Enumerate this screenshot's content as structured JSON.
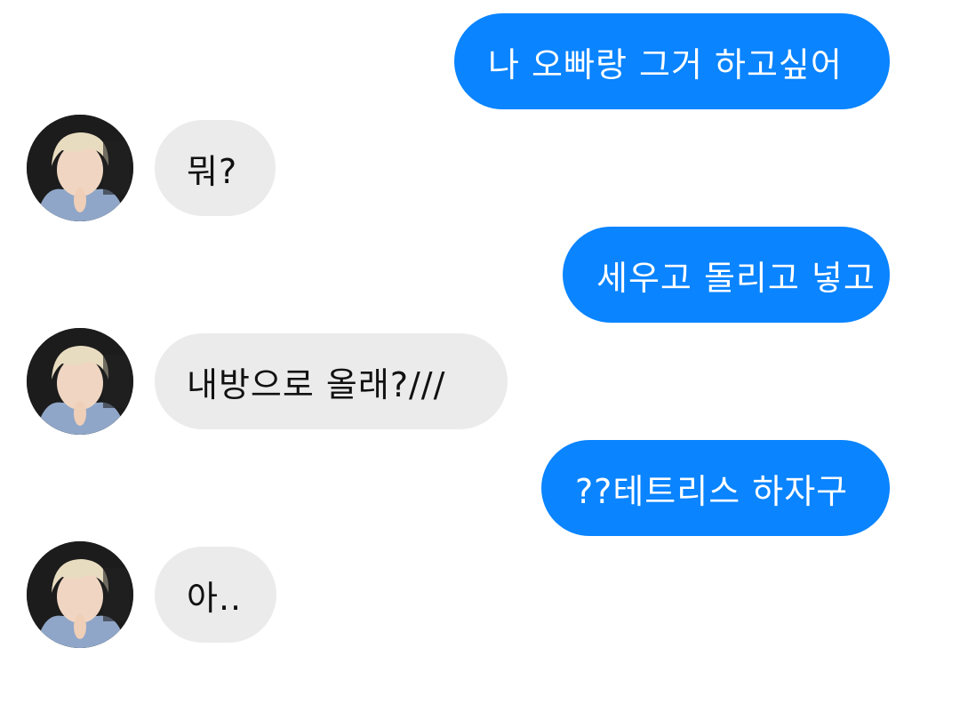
{
  "messages": [
    {
      "side": "sent",
      "text": "나 오빠랑 그거 하고싶어"
    },
    {
      "side": "received",
      "text": "뭐?"
    },
    {
      "side": "sent",
      "text": "세우고 돌리고 넣고"
    },
    {
      "side": "received",
      "text": "내방으로 올래?///"
    },
    {
      "side": "sent",
      "text": "??테트리스 하자구"
    },
    {
      "side": "received",
      "text": "아.."
    }
  ],
  "colors": {
    "sent_bubble": "#0a84ff",
    "sent_text": "#ffffff",
    "received_bubble": "#ebebeb",
    "received_text": "#111111",
    "background": "#ffffff"
  },
  "icons": {
    "avatar": "contact-profile-photo"
  }
}
